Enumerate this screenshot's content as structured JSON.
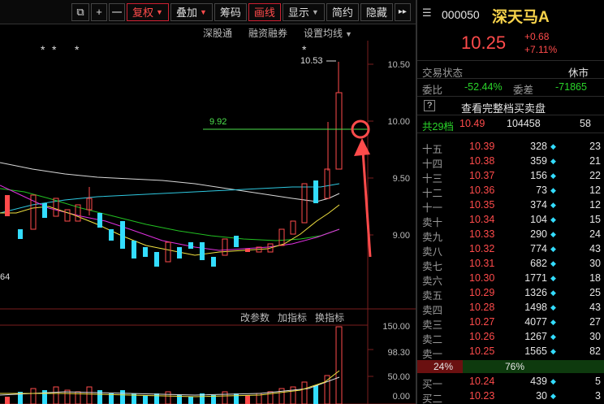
{
  "toolbar": {
    "buttons": [
      "+",
      "一",
      "复权",
      "叠加",
      "筹码",
      "画线",
      "显示",
      "简约",
      "隐藏"
    ],
    "more": "▸▸"
  },
  "subbar": {
    "items": [
      "深股通",
      "融资融券",
      "设置均线"
    ]
  },
  "chart": {
    "stars": [
      "*",
      "*",
      "*",
      "*"
    ],
    "high_label": "10.53",
    "line_label": "9.92",
    "low_label": "64",
    "yaxis": [
      "10.50",
      "10.00",
      "9.50",
      "9.00"
    ],
    "vol_axis": [
      "150.00",
      "98.30",
      "50.00",
      "0.00"
    ],
    "vol_tabs": [
      "改参数",
      "加指标",
      "换指标"
    ]
  },
  "quote": {
    "code": "000050",
    "name": "深天马A",
    "price": "10.25",
    "change": "+0.68",
    "change_pct": "+7.11%",
    "status_label": "交易状态",
    "status_value": "休市",
    "ratio_label": "委比",
    "ratio_value": "-52.44%",
    "diff_label": "委差",
    "diff_value": "-71865",
    "help": "?",
    "full_book": "查看完整档买卖盘",
    "total_label": "共29档",
    "total_price": "10.49",
    "total_vol": "104458",
    "total_cnt": "58",
    "asks": [
      {
        "label": "十五",
        "price": "10.39",
        "vol": "328",
        "cnt": "23"
      },
      {
        "label": "十四",
        "price": "10.38",
        "vol": "359",
        "cnt": "21"
      },
      {
        "label": "十三",
        "price": "10.37",
        "vol": "156",
        "cnt": "22"
      },
      {
        "label": "十二",
        "price": "10.36",
        "vol": "73",
        "cnt": "12"
      },
      {
        "label": "十一",
        "price": "10.35",
        "vol": "374",
        "cnt": "12"
      },
      {
        "label": "卖十",
        "price": "10.34",
        "vol": "104",
        "cnt": "15"
      },
      {
        "label": "卖九",
        "price": "10.33",
        "vol": "290",
        "cnt": "24"
      },
      {
        "label": "卖八",
        "price": "10.32",
        "vol": "774",
        "cnt": "43"
      },
      {
        "label": "卖七",
        "price": "10.31",
        "vol": "682",
        "cnt": "30"
      },
      {
        "label": "卖六",
        "price": "10.30",
        "vol": "1771",
        "cnt": "18"
      },
      {
        "label": "卖五",
        "price": "10.29",
        "vol": "1326",
        "cnt": "25"
      },
      {
        "label": "卖四",
        "price": "10.28",
        "vol": "1498",
        "cnt": "43"
      },
      {
        "label": "卖三",
        "price": "10.27",
        "vol": "4077",
        "cnt": "27"
      },
      {
        "label": "卖二",
        "price": "10.26",
        "vol": "1267",
        "cnt": "30"
      },
      {
        "label": "卖一",
        "price": "10.25",
        "vol": "1565",
        "cnt": "82"
      }
    ],
    "ratio_bar": {
      "left": "24%",
      "right": "76%",
      "left_frac": 0.24
    },
    "bids": [
      {
        "label": "买一",
        "price": "10.24",
        "vol": "439",
        "cnt": "5"
      },
      {
        "label": "买二",
        "price": "10.23",
        "vol": "30",
        "cnt": "3"
      }
    ]
  },
  "colors": {
    "red": "#ff4b4b",
    "green": "#2ad42a",
    "cyan": "#33ddff",
    "yellow": "#f7d34b"
  }
}
